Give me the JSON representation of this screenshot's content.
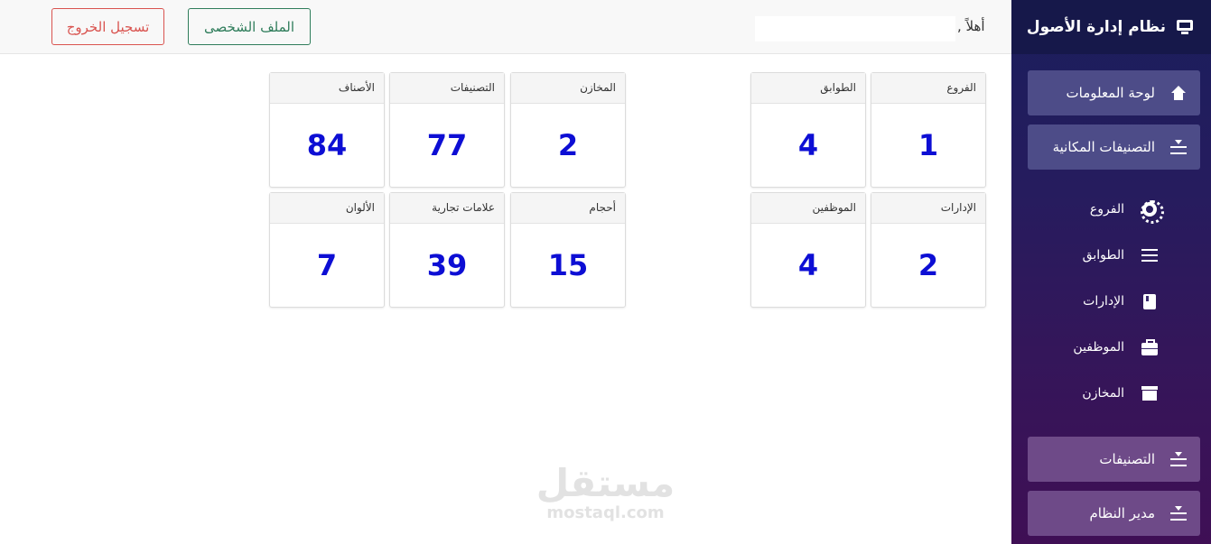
{
  "app": {
    "title": "نظام إدارة الأصول"
  },
  "topbar": {
    "greeting": "أهلاً ,",
    "profile_label": "الملف الشخصى",
    "logout_label": "تسجيل الخروج"
  },
  "sidebar": {
    "dashboard": "لوحة المعلومات",
    "spatial": "التصنيفات المكانية",
    "sub_items": [
      "الفروع",
      "الطوابق",
      "الإدارات",
      "الموظفين",
      "المخازن"
    ],
    "classifications": "التصنيفات",
    "system_admin": "مدير النظام"
  },
  "cards": [
    {
      "label": "الفروع",
      "value": "1"
    },
    {
      "label": "الطوابق",
      "value": "4"
    },
    {
      "label": "المخازن",
      "value": "2"
    },
    {
      "label": "التصنيفات",
      "value": "77"
    },
    {
      "label": "الأصناف",
      "value": "84"
    },
    {
      "label": "الإدارات",
      "value": "2"
    },
    {
      "label": "الموظفين",
      "value": "4"
    },
    {
      "label": "أحجام",
      "value": "15"
    },
    {
      "label": "علامات تجارية",
      "value": "39"
    },
    {
      "label": "الألوان",
      "value": "7"
    }
  ],
  "watermark": {
    "arabic": "مستقل",
    "latin": "mostaql.com"
  },
  "colors": {
    "accent_value": "#0d0ed4",
    "profile": "#2f7d5b",
    "logout": "#d9534f"
  }
}
